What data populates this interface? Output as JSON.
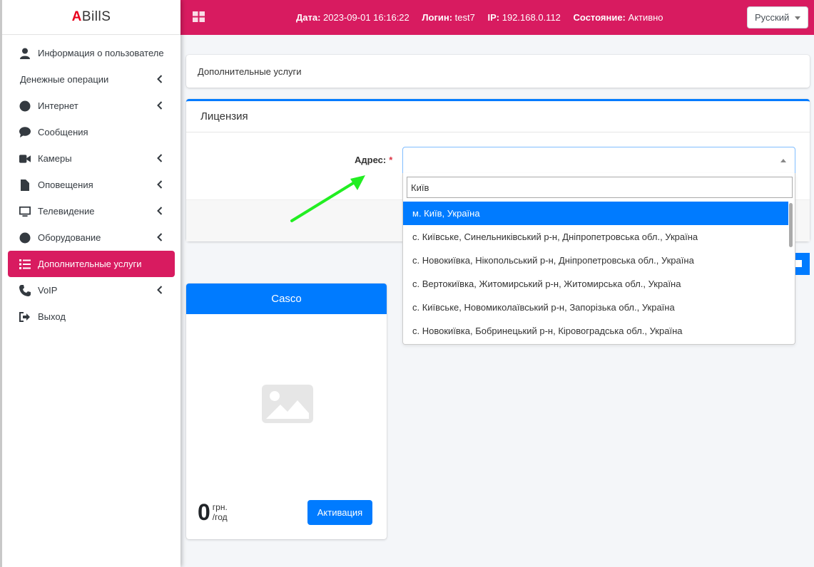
{
  "brand": {
    "first_letter": "A",
    "rest": "BillS"
  },
  "sidebar": {
    "items": [
      {
        "label": "Информация о пользователе",
        "icon": "user-icon",
        "has_chevron": false
      },
      {
        "label": "Денежные операции",
        "icon": "",
        "has_chevron": true
      },
      {
        "label": "Интернет",
        "icon": "globe-icon",
        "has_chevron": true
      },
      {
        "label": "Сообщения",
        "icon": "comment-icon",
        "has_chevron": false
      },
      {
        "label": "Камеры",
        "icon": "video-icon",
        "has_chevron": true
      },
      {
        "label": "Оповещения",
        "icon": "file-icon",
        "has_chevron": true
      },
      {
        "label": "Телевидение",
        "icon": "tv-icon",
        "has_chevron": true
      },
      {
        "label": "Оборудование",
        "icon": "circle-icon",
        "has_chevron": true
      },
      {
        "label": "Дополнительные услуги",
        "icon": "list-icon",
        "has_chevron": false,
        "active": true
      },
      {
        "label": "VoIP",
        "icon": "phone-icon",
        "has_chevron": true
      },
      {
        "label": "Выход",
        "icon": "sign-out-icon",
        "has_chevron": false
      }
    ]
  },
  "topbar": {
    "date_label": "Дата:",
    "date_value": "2023-09-01 16:16:22",
    "login_label": "Логин:",
    "login_value": "test7",
    "ip_label": "IP:",
    "ip_value": "192.168.0.112",
    "state_label": "Состояние:",
    "state_value": "Активно",
    "language": "Русский"
  },
  "breadcrumb": "Дополнительные услуги",
  "license_card": {
    "title": "Лицензия",
    "address_label": "Адрес:",
    "required_mark": "*"
  },
  "address_dropdown": {
    "search_value": "Київ",
    "options": [
      "м. Київ, Україна",
      "с. Київське, Синельниківський р-н, Дніпропетровська обл., Україна",
      "с. Новокиївка, Нікопольський р-н, Дніпропетровська обл., Україна",
      "с. Вертокиївка, Житомирський р-н, Житомирська обл., Україна",
      "с. Київське, Новомиколаївський р-н, Запорізька обл., Україна",
      "с. Новокиївка, Бобринецький р-н, Кіровоградська обл., Україна"
    ],
    "selected_index": 0
  },
  "product": {
    "name": "Casco",
    "price": "0",
    "currency": "грн.",
    "period": "/год",
    "activate_label": "Активация"
  },
  "colors": {
    "accent": "#d81b60",
    "primary": "#007bff",
    "annotation_arrow": "#22ee22"
  }
}
